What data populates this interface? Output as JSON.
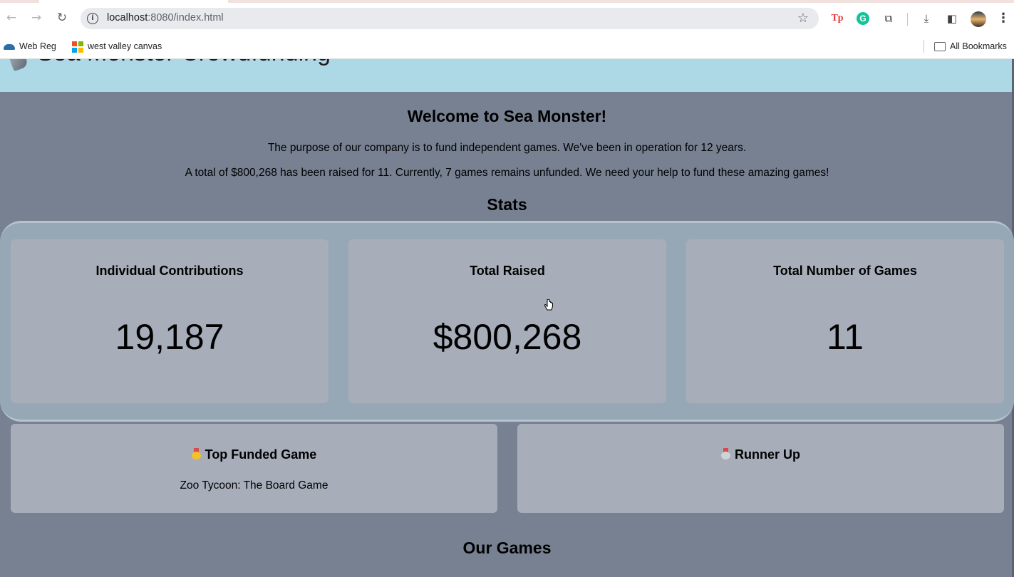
{
  "browser": {
    "url_host": "localhost",
    "url_path": ":8080/index.html",
    "bookmarks": [
      {
        "label": "Web Reg"
      },
      {
        "label": "west valley canvas"
      }
    ],
    "all_bookmarks_label": "All Bookmarks",
    "extension_tp_label": "Tp",
    "extension_grammarly_label": "G"
  },
  "page": {
    "header_title": "Sea Monster Crowdfunding",
    "welcome_title": "Welcome to Sea Monster!",
    "intro_line1": "The purpose of our company is to fund independent games. We've been in operation for 12 years.",
    "intro_line2": "A total of $800,268 has been raised for 11. Currently, 7 games remains unfunded. We need your help to fund these amazing games!",
    "stats_title": "Stats",
    "stats": [
      {
        "label": "Individual Contributions",
        "value": "19,187"
      },
      {
        "label": "Total Raised",
        "value": "$800,268"
      },
      {
        "label": "Total Number of Games",
        "value": "11"
      }
    ],
    "top_funded_label": "Top Funded Game",
    "top_funded_game": "Zoo Tycoon: The Board Game",
    "runner_up_label": "Runner Up",
    "runner_up_game": "",
    "our_games_title": "Our Games",
    "colors": {
      "header_bg": "#add8e6",
      "page_bg": "#778192",
      "card_bg": "#a7adb9",
      "stats_container_bg": "#96a8b5"
    }
  }
}
